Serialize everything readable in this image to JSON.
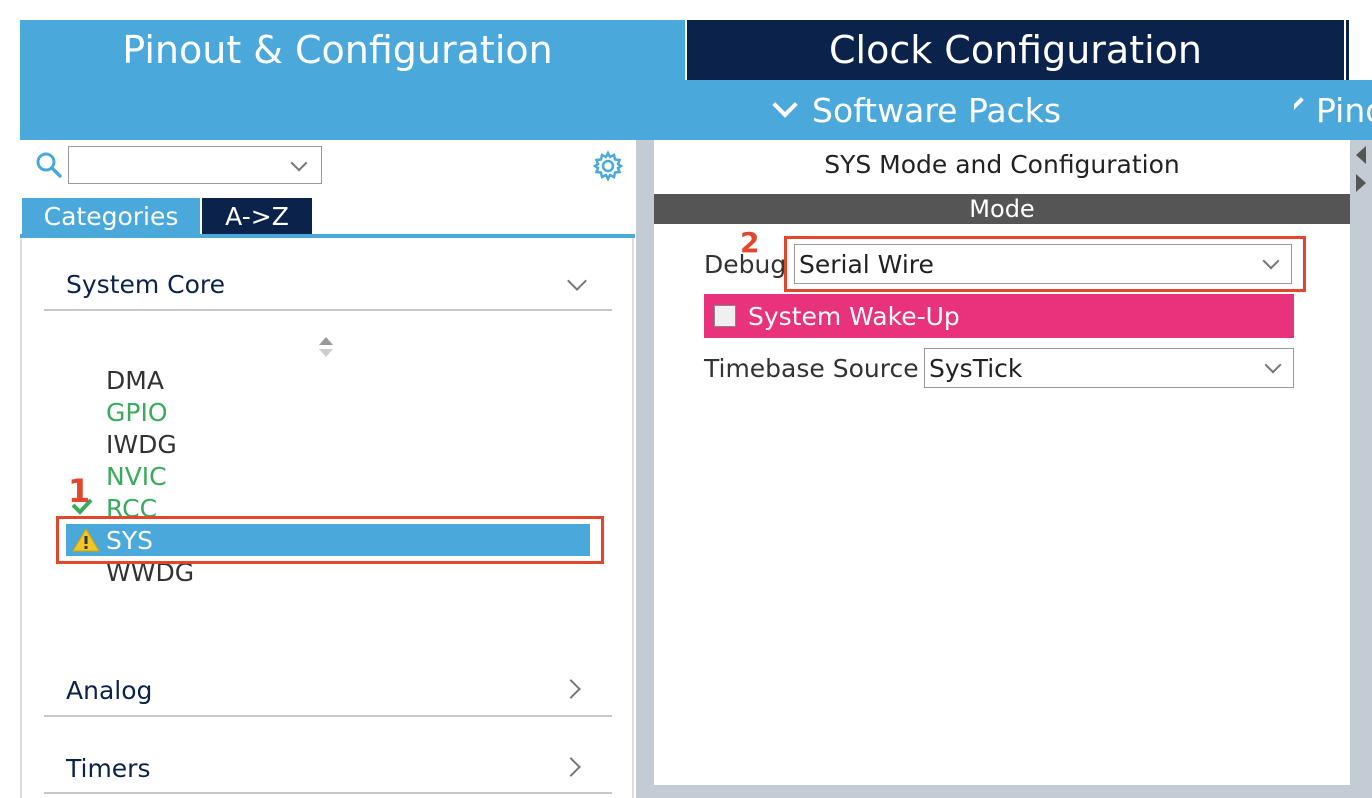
{
  "top_tabs": {
    "pinout": "Pinout & Configuration",
    "clock": "Clock Configuration"
  },
  "menu": {
    "software_packs": "Software Packs",
    "pinout_menu": "Pinout"
  },
  "left": {
    "search": {
      "value": "",
      "placeholder": ""
    },
    "tabs": {
      "categories": "Categories",
      "az": "A->Z"
    },
    "sections": [
      {
        "label": "System Core",
        "expanded": true
      },
      {
        "label": "Analog",
        "expanded": false
      },
      {
        "label": "Timers",
        "expanded": false
      }
    ],
    "system_core_items": [
      {
        "label": "DMA",
        "status": "default"
      },
      {
        "label": "GPIO",
        "status": "configured"
      },
      {
        "label": "IWDG",
        "status": "default"
      },
      {
        "label": "NVIC",
        "status": "configured"
      },
      {
        "label": "RCC",
        "status": "configured"
      },
      {
        "label": "SYS",
        "status": "warning",
        "selected": true
      },
      {
        "label": "WWDG",
        "status": "default"
      }
    ]
  },
  "annotations": {
    "one": "1",
    "two": "2"
  },
  "right": {
    "title": "SYS Mode and Configuration",
    "mode_header": "Mode",
    "debug_label": "Debug",
    "debug_value": "Serial Wire",
    "wakeup_label": "System Wake-Up",
    "wakeup_checked": false,
    "timebase_label": "Timebase Source",
    "timebase_value": "SysTick"
  },
  "colors": {
    "accent_blue": "#4aa8db",
    "navy": "#0b234a",
    "configured_green": "#3aaa5c",
    "highlight_pink": "#e9327c",
    "annotation_red": "#e0472c"
  }
}
